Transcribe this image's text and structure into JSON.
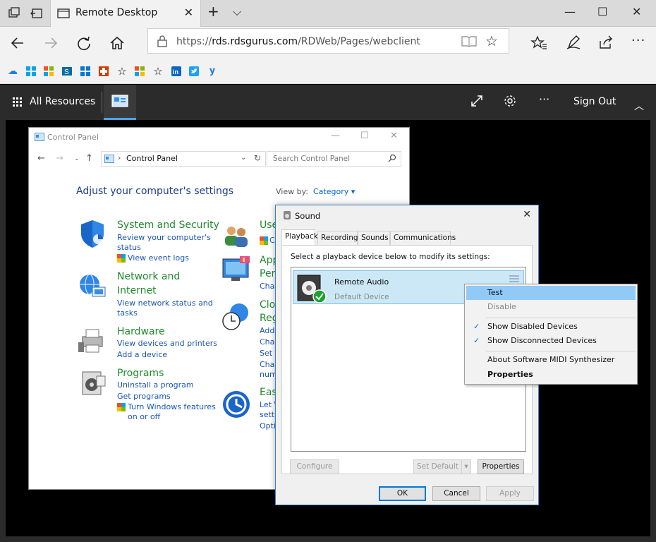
{
  "browser": {
    "tab_title": "Remote Desktop",
    "url_prefix": "https://",
    "url_domain": "rds.rdsgurus.com",
    "url_path": "/RDWeb/Pages/webclient"
  },
  "rdweb": {
    "all_resources": "All Resources",
    "sign_out": "Sign Out"
  },
  "control_panel": {
    "title": "Control Panel",
    "breadcrumb": "Control Panel",
    "search_placeholder": "Search Control Panel",
    "heading": "Adjust your computer's settings",
    "view_by_label": "View by:",
    "view_by_value": "Category",
    "categories_left": [
      {
        "title": "System and Security",
        "links": [
          "Review your computer's",
          "status",
          "View event logs"
        ]
      },
      {
        "title": "Network and",
        "title2": "Internet",
        "links": [
          "View network status and",
          "tasks"
        ]
      },
      {
        "title": "Hardware",
        "links": [
          "View devices and printers",
          "Add a device"
        ]
      },
      {
        "title": "Programs",
        "links": [
          "Uninstall a program",
          "Get programs",
          "Turn Windows features",
          "on or off"
        ]
      }
    ],
    "categories_right": [
      {
        "title": "Use",
        "links": [
          "C"
        ]
      },
      {
        "title": "App",
        "title2": "Pers",
        "links": [
          "Char"
        ]
      },
      {
        "title": "Clo",
        "title2": "Reg",
        "links": [
          "Add",
          "Char",
          "Set t",
          "Char",
          "num"
        ]
      },
      {
        "title": "Eas",
        "links": [
          "Let V",
          "setti",
          "Opti"
        ]
      }
    ]
  },
  "sound": {
    "title": "Sound",
    "tabs": [
      "Playback",
      "Recording",
      "Sounds",
      "Communications"
    ],
    "instruction": "Select a playback device below to modify its settings:",
    "device_name": "Remote Audio",
    "device_status": "Default Device",
    "buttons": {
      "configure": "Configure",
      "set_default": "Set Default",
      "properties": "Properties",
      "ok": "OK",
      "cancel": "Cancel",
      "apply": "Apply"
    }
  },
  "context_menu": {
    "items": [
      "Test",
      "Disable",
      "Show Disabled Devices",
      "Show Disconnected Devices",
      "About Software MIDI Synthesizer",
      "Properties"
    ]
  }
}
